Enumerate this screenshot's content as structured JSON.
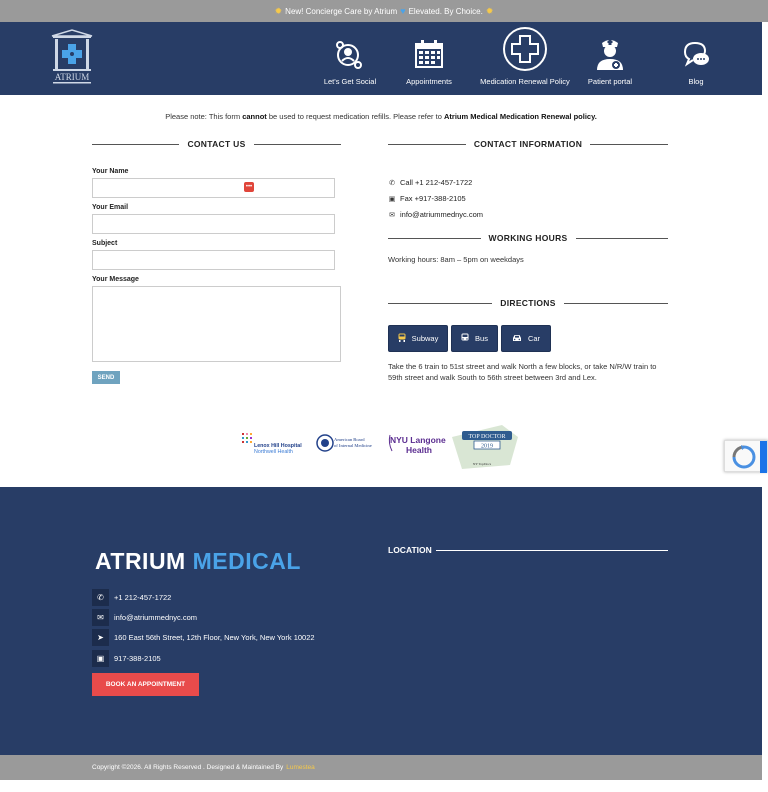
{
  "announcement": {
    "text_1": "New! Concierge Care by Atrium",
    "text_2": "Elevated. By Choice."
  },
  "header": {
    "logo_text": "ATRIUM",
    "nav": [
      {
        "label": "Let's Get Social",
        "icon": "social-icon"
      },
      {
        "label": "Appointments",
        "icon": "calendar-icon"
      },
      {
        "label": "Medication Renewal Policy",
        "icon": "medical-cross-icon"
      },
      {
        "label": "Patient portal",
        "icon": "nurse-icon"
      },
      {
        "label": "Blog",
        "icon": "chat-bubble-icon"
      }
    ]
  },
  "notice": {
    "prefix": "Please note: This form",
    "bold_1": "cannot",
    "middle": "be used to request medication refills. Please refer to",
    "bold_2": "Atrium Medical Medication Renewal policy."
  },
  "contact_form": {
    "title": "CONTACT US",
    "name_label": "Your Name",
    "email_label": "Your Email",
    "subject_label": "Subject",
    "message_label": "Your Message",
    "send_label": "SEND"
  },
  "contact_info": {
    "title": "CONTACT INFORMATION",
    "call": "Call +1 212-457-1722",
    "fax": "Fax +917-388-2105",
    "email": "info@atriummednyc.com"
  },
  "working_hours": {
    "title": "WORKING HOURS",
    "text": "Working hours: 8am – 5pm on weekdays"
  },
  "directions": {
    "title": "DIRECTIONS",
    "buttons": [
      "Subway",
      "Bus",
      "Car"
    ],
    "text": "Take the 6 train to 51st street and walk North a few blocks, or take N/R/W train to 59th street and walk South to 56th street between 3rd and Lex."
  },
  "partners": {
    "lenox_1": "Lenox Hill Hospital",
    "lenox_2": "Northwell Health",
    "abim_1": "American Board",
    "abim_2": "of Internal Medicine",
    "nyu_1": "NYU Langone",
    "nyu_2": "Health",
    "topdoc_1": "TOP DOCTOR",
    "topdoc_2": "2019",
    "topdoc_3": "NY TopDocs"
  },
  "footer": {
    "brand_white": "ATRIUM",
    "brand_blue": "MEDICAL",
    "phone": "+1 212-457-1722",
    "email": "info@atriummednyc.com",
    "address": "160 East 56th Street, 12th Floor, New York, New York 10022",
    "fax": "917-388-2105",
    "book_label": "BOOK AN APPOINTMENT",
    "location_title": "LOCATION"
  },
  "copyright": {
    "text": "Copyright ©2026. All Rights Reserved . Designed & Maintained By",
    "link": "Lumestea"
  },
  "colors": {
    "navy": "#283d66",
    "accent_blue": "#4aa3e8",
    "book_red": "#e84b4b",
    "send_blue": "#6fa3bf",
    "gold": "#f6c94a"
  }
}
